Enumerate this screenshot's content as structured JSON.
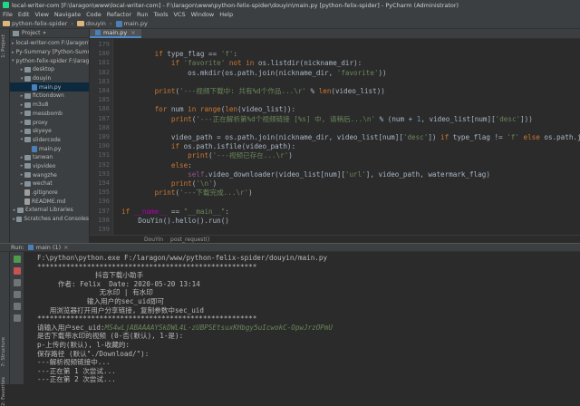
{
  "window": {
    "title": "local-writer-com [F:\\laragon\\www\\local-writer-com] - F:\\laragon\\www\\python-felix-spider\\douyin\\main.py [python-felix-spider] - PyCharm (Administrator)"
  },
  "menu": [
    "File",
    "Edit",
    "View",
    "Navigate",
    "Code",
    "Refactor",
    "Run",
    "Tools",
    "VCS",
    "Window",
    "Help"
  ],
  "breadcrumb": [
    "python-felix-spider",
    "douyin",
    "main.py"
  ],
  "project": {
    "header": "Project",
    "items": [
      {
        "label": "local-writer-com F:\\laragon\\www\\local-writer-com",
        "indent": 0,
        "arrow": "▸",
        "type": "root"
      },
      {
        "label": "Py-Summary [Python-Summary] F:\\laragon\\www\\Py-Summary",
        "indent": 0,
        "arrow": "▸",
        "type": "root"
      },
      {
        "label": "python-felix-spider F:\\laragon\\www\\python-felix-spider",
        "indent": 0,
        "arrow": "▾",
        "type": "root"
      },
      {
        "label": "desktop",
        "indent": 1,
        "arrow": "▸",
        "type": "dir"
      },
      {
        "label": "douyin",
        "indent": 1,
        "arrow": "▾",
        "type": "dir"
      },
      {
        "label": "main.py",
        "indent": 2,
        "arrow": "",
        "type": "py",
        "selected": true
      },
      {
        "label": "fictiondown",
        "indent": 1,
        "arrow": "▸",
        "type": "dir"
      },
      {
        "label": "m3u8",
        "indent": 1,
        "arrow": "▸",
        "type": "dir"
      },
      {
        "label": "messbomb",
        "indent": 1,
        "arrow": "▸",
        "type": "dir"
      },
      {
        "label": "proxy",
        "indent": 1,
        "arrow": "▸",
        "type": "dir"
      },
      {
        "label": "skyeye",
        "indent": 1,
        "arrow": "▸",
        "type": "dir"
      },
      {
        "label": "slidercode",
        "indent": 1,
        "arrow": "▾",
        "type": "dir"
      },
      {
        "label": "main.py",
        "indent": 2,
        "arrow": "",
        "type": "py"
      },
      {
        "label": "tanwan",
        "indent": 1,
        "arrow": "▸",
        "type": "dir"
      },
      {
        "label": "vipvideo",
        "indent": 1,
        "arrow": "▸",
        "type": "dir"
      },
      {
        "label": "wangzhe",
        "indent": 1,
        "arrow": "▸",
        "type": "dir"
      },
      {
        "label": "wechat",
        "indent": 1,
        "arrow": "▸",
        "type": "dir"
      },
      {
        "label": ".gitignore",
        "indent": 1,
        "arrow": "",
        "type": "txt"
      },
      {
        "label": "README.md",
        "indent": 1,
        "arrow": "",
        "type": "txt"
      },
      {
        "label": "External Libraries",
        "indent": 0,
        "arrow": "▸",
        "type": "dir"
      },
      {
        "label": "Scratches and Consoles",
        "indent": 0,
        "arrow": "▸",
        "type": "dir"
      }
    ]
  },
  "editor": {
    "tab": "main.py",
    "crumbs": [
      "DouYin",
      "post_request()"
    ]
  },
  "code_lines": [
    {
      "num": "179",
      "html": ""
    },
    {
      "num": "180",
      "html": "        <span class=\"kw\">if</span> type_flag == <span class=\"st\">'f'</span>:"
    },
    {
      "num": "181",
      "html": "            <span class=\"kw\">if</span> <span class=\"st\">'favorite'</span> <span class=\"kw\">not in</span> os.listdir(nickname_dir):"
    },
    {
      "num": "182",
      "html": "                os.mkdir(os.path.join(nickname_dir, <span class=\"st\">'favorite'</span>))"
    },
    {
      "num": "183",
      "html": ""
    },
    {
      "num": "184",
      "html": "        <span class=\"kw\">print</span>(<span class=\"st\">'---视频下载中: 共有%d个作品...\\r'</span> % <span class=\"kw\">len</span>(video_list))"
    },
    {
      "num": "185",
      "html": ""
    },
    {
      "num": "186",
      "html": "        <span class=\"kw\">for</span> num <span class=\"kw\">in</span> <span class=\"kw\">range</span>(<span class=\"kw\">len</span>(video_list)):"
    },
    {
      "num": "187",
      "html": "            <span class=\"kw\">print</span>(<span class=\"st\">'---正在解析第%d个视频链接 [%s] 中, 请稍后...\\n'</span> % (num + <span class=\"nm\">1</span>, video_list[num][<span class=\"st\">'desc'</span>]))"
    },
    {
      "num": "188",
      "html": ""
    },
    {
      "num": "189",
      "html": "            video_path = os.path.join(nickname_dir, video_list[num][<span class=\"st\">'desc'</span>]) <span class=\"kw\">if</span> type_flag != <span class=\"st\">'f'</span> <span class=\"kw\">else</span> os.path.join(n"
    },
    {
      "num": "190",
      "html": "            <span class=\"kw\">if</span> os.path.isfile(video_path):"
    },
    {
      "num": "191",
      "html": "                <span class=\"kw\">print</span>(<span class=\"st\">'---视频已存在...\\r'</span>)"
    },
    {
      "num": "192",
      "html": "            <span class=\"kw\">else</span>:"
    },
    {
      "num": "193",
      "html": "                <span class=\"sl\">self</span>.video_downloader(video_list[num][<span class=\"st\">'url'</span>], video_path, watermark_flag)"
    },
    {
      "num": "194",
      "html": "            <span class=\"kw\">print</span>(<span class=\"st\">'\\n'</span>)"
    },
    {
      "num": "195",
      "html": "        <span class=\"kw\">print</span>(<span class=\"st\">'---下载完成...\\r'</span>)"
    },
    {
      "num": "196",
      "html": ""
    },
    {
      "num": "197",
      "html": "<span class=\"kw\">if</span> <span class=\"mg\">__name__</span> == <span class=\"st\">\"__main__\"</span>:"
    },
    {
      "num": "198",
      "html": "    DouYin().hello().run()"
    },
    {
      "num": "199",
      "html": ""
    }
  ],
  "run": {
    "label": "Run:",
    "tab": "main (1)"
  },
  "console_lines": [
    {
      "text": "F:\\python\\python.exe F:/laragon/www/python-felix-spider/douyin/main.py",
      "input": false
    },
    {
      "text": "*****************************************************",
      "input": false
    },
    {
      "text": "              抖音下载小助手",
      "input": false
    },
    {
      "text": "     作者: Felix  Date: 2020-05-20 13:14",
      "input": false
    },
    {
      "text": "               无水印 | 有水印",
      "input": false
    },
    {
      "text": "            输入用户的sec_uid即可",
      "input": false
    },
    {
      "text": "   用浏览器打开用户分享链接, 复制参数中sec_uid",
      "input": false
    },
    {
      "text": "*****************************************************",
      "input": false
    },
    {
      "text": "请输入用户sec_uid:",
      "input_part": "MS4wLjABAAAAYSkDWL4L-zUBPSEtsuxKHbgy5uIcwokC-OpwJrzOPmU",
      "input": false
    },
    {
      "text": "是否下载带水印的视频 (0-否(默认), 1-是):",
      "input": false
    },
    {
      "text": "p-上传的(默认), l-收藏的:",
      "input": false
    },
    {
      "text": "保存路径 (默认\"./Download/\"):",
      "input": false
    },
    {
      "text": "---解析视频链接中...",
      "input": false
    },
    {
      "text": "---正在第 1 次尝试...",
      "input": false
    },
    {
      "text": "---正在第 2 次尝试...",
      "input": false
    }
  ],
  "left_tabs": {
    "project": "1: Project",
    "structure": "7: Structure",
    "favorites": "2: Favorites"
  }
}
